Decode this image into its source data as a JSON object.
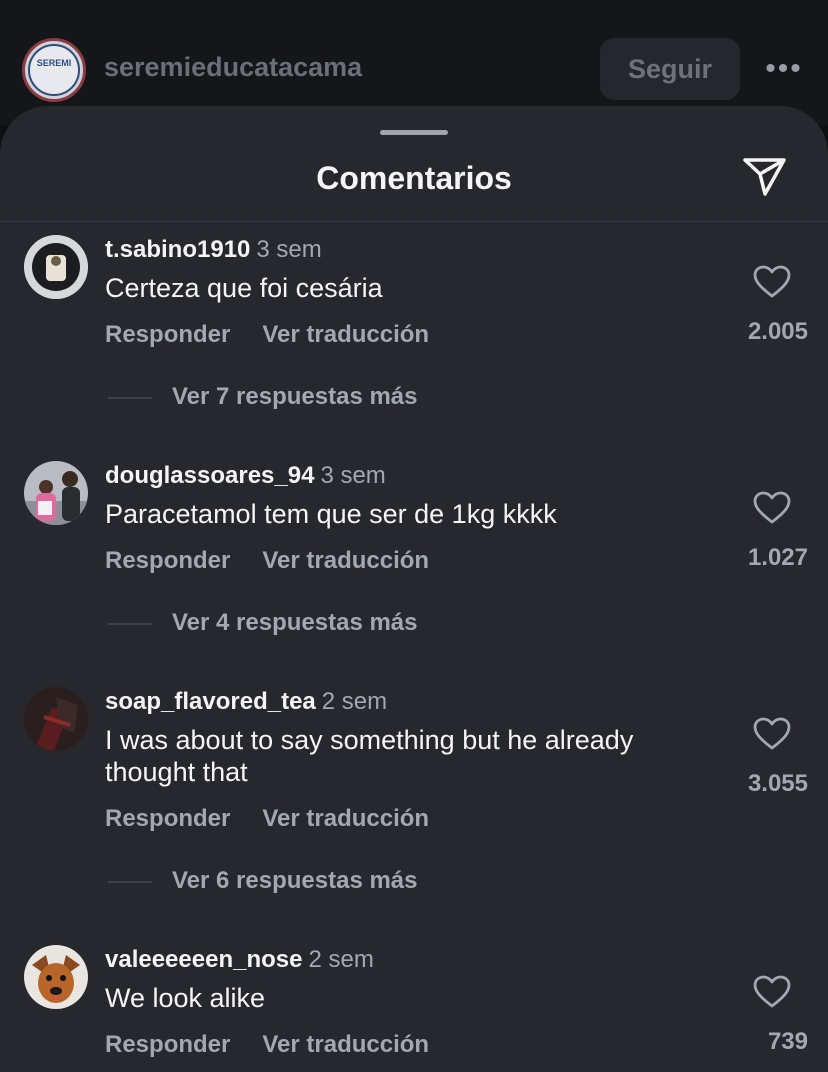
{
  "post": {
    "username": "seremieducatacama",
    "avatar_text": "SEREMI",
    "follow_label": "Seguir",
    "more_label": "•••"
  },
  "sheet": {
    "title": "Comentarios"
  },
  "comments": [
    {
      "username": "t.sabino1910",
      "time": "3 sem",
      "text": "Certeza que foi cesária",
      "reply_label": "Responder",
      "translate_label": "Ver traducción",
      "likes": "2.005",
      "replies_label": "Ver 7 respuestas más"
    },
    {
      "username": "douglassoares_94",
      "time": "3 sem",
      "text": "Paracetamol tem que ser de 1kg kkkk",
      "reply_label": "Responder",
      "translate_label": "Ver traducción",
      "likes": "1.027",
      "replies_label": "Ver 4 respuestas más"
    },
    {
      "username": "soap_flavored_tea",
      "time": "2 sem",
      "text": "I was about to say something but he already thought that",
      "reply_label": "Responder",
      "translate_label": "Ver traducción",
      "likes": "3.055",
      "replies_label": "Ver 6 respuestas más"
    },
    {
      "username": "valeeeeeen_nose",
      "time": "2 sem",
      "text": "We look alike",
      "reply_label": "Responder",
      "translate_label": "Ver traducción",
      "likes": "739"
    }
  ],
  "colors": {
    "sheet_bg": "#26282d",
    "primary_text": "#f5f5f5",
    "secondary_text": "#a4a7ad"
  }
}
